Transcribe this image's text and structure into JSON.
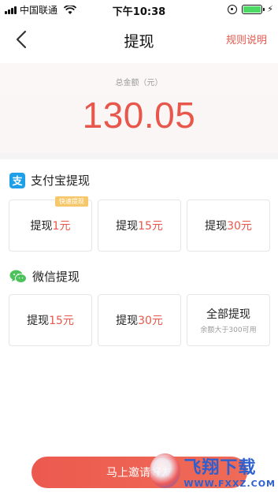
{
  "status_bar": {
    "carrier": "中国联通",
    "time": "下午10:38"
  },
  "nav": {
    "title": "提现",
    "rules_link": "规则说明"
  },
  "balance": {
    "label": "总金额（元）",
    "value": "130.05"
  },
  "alipay": {
    "title": "支付宝提现",
    "icon_glyph": "支",
    "options": [
      {
        "prefix": "提现",
        "amount": "1元",
        "badge": "快速提现"
      },
      {
        "prefix": "提现",
        "amount": "15元"
      },
      {
        "prefix": "提现",
        "amount": "30元"
      }
    ]
  },
  "wechat": {
    "title": "微信提现",
    "options": [
      {
        "prefix": "提现",
        "amount": "15元"
      },
      {
        "prefix": "提现",
        "amount": "30元"
      },
      {
        "label": "全部提现",
        "sub": "余额大于300可用"
      }
    ]
  },
  "invite_button": {
    "label": "马上邀请好友"
  },
  "watermark": {
    "cn": "飞翔下载",
    "en": "WWW.FXXZ.COM"
  },
  "colors": {
    "accent": "#e8574b",
    "alipay": "#1ea0e8",
    "wechat": "#4bc25a"
  }
}
